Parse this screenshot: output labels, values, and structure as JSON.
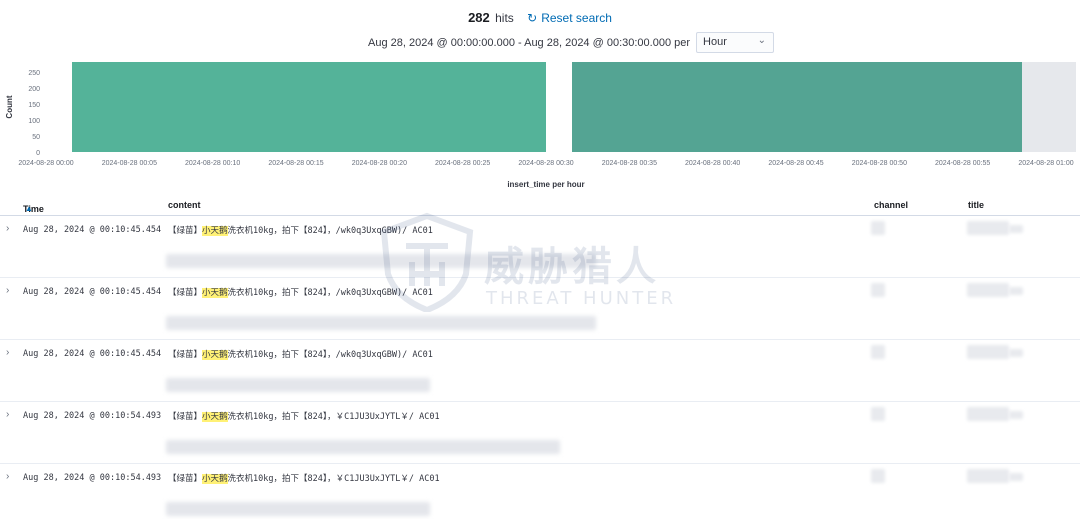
{
  "header": {
    "hits_count": "282",
    "hits_label": "hits",
    "reset_label": "Reset search",
    "range_text": "Aug 28, 2024 @ 00:00:00.000 - Aug 28, 2024 @ 00:30:00.000 per",
    "interval_value": "Hour"
  },
  "chart_data": {
    "type": "bar",
    "xlabel": "insert_time per hour",
    "ylabel": "Count",
    "ylim": [
      0,
      282
    ],
    "yticks": [
      0,
      50,
      100,
      150,
      200,
      250
    ],
    "xticks": [
      "2024-08-28 00:00",
      "2024-08-28 00:05",
      "2024-08-28 00:10",
      "2024-08-28 00:15",
      "2024-08-28 00:20",
      "2024-08-28 00:25",
      "2024-08-28 00:30",
      "2024-08-28 00:35",
      "2024-08-28 00:40",
      "2024-08-28 00:45",
      "2024-08-28 00:50",
      "2024-08-28 00:55",
      "2024-08-28 01:00"
    ],
    "bars": [
      {
        "x_start_min": 0,
        "x_end_min": 30,
        "value": 282,
        "color": "#54b399"
      },
      {
        "x_start_min": 30,
        "x_end_min": 57,
        "value": 282,
        "color": "#54a493"
      }
    ],
    "x_max_min": 60,
    "shaded_after_min": 57,
    "grid": true
  },
  "table": {
    "columns": {
      "time": "Time",
      "content": "content",
      "channel": "channel",
      "title": "title"
    },
    "rows": [
      {
        "time": "Aug 28, 2024 @ 00:10:45.454",
        "pre": "【绿苗】",
        "highlight": "小天鹅",
        "post": "洗衣机10kg，拍下【824】，/wk0q3UxqGBW)/ AC01"
      },
      {
        "time": "Aug 28, 2024 @ 00:10:45.454",
        "pre": "【绿苗】",
        "highlight": "小天鹅",
        "post": "洗衣机10kg，拍下【824】，/wk0q3UxqGBW)/ AC01"
      },
      {
        "time": "Aug 28, 2024 @ 00:10:45.454",
        "pre": "【绿苗】",
        "highlight": "小天鹅",
        "post": "洗衣机10kg，拍下【824】，/wk0q3UxqGBW)/ AC01"
      },
      {
        "time": "Aug 28, 2024 @ 00:10:54.493",
        "pre": "【绿苗】",
        "highlight": "小天鹅",
        "post": "洗衣机10kg，拍下【824】，￥C1JU3UxJYTL￥/ AC01"
      },
      {
        "time": "Aug 28, 2024 @ 00:10:54.493",
        "pre": "【绿苗】",
        "highlight": "小天鹅",
        "post": "洗衣机10kg，拍下【824】，￥C1JU3UxJYTL￥/ AC01"
      }
    ]
  },
  "watermark": {
    "cn": "威胁猎人",
    "en": "THREAT HUNTER"
  }
}
